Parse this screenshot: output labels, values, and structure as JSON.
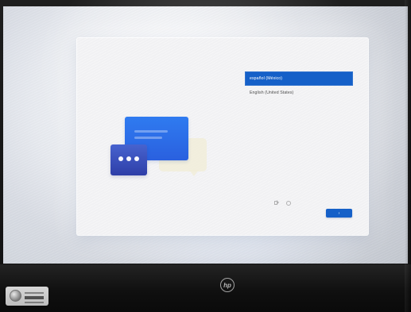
{
  "languages": [
    {
      "label": "español (México)",
      "selected": true
    },
    {
      "label": "English (United States)",
      "selected": false
    }
  ],
  "next_button_label": "›",
  "brand_logo_text": "hp",
  "colors": {
    "accent": "#1560c8",
    "illustration_primary": "#2f7bf0",
    "illustration_secondary": "#3448b8"
  }
}
